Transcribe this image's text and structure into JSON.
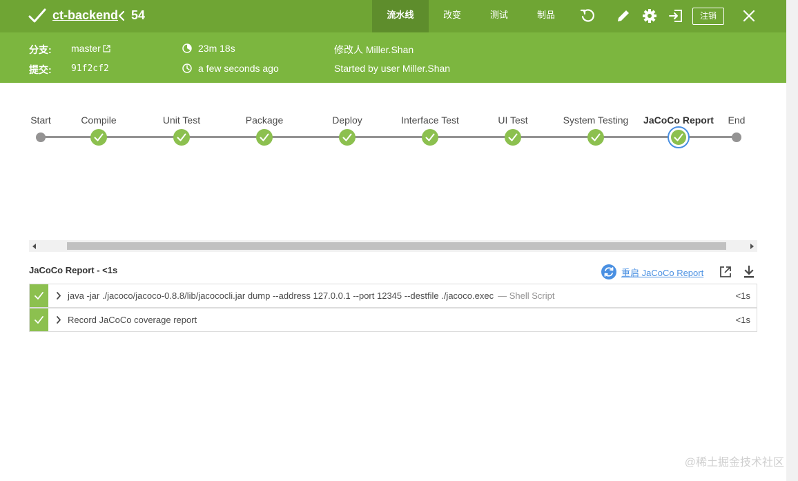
{
  "header": {
    "project_name": "ct-backend",
    "run_number": "54",
    "tabs": [
      {
        "label": "流水线",
        "active": true
      },
      {
        "label": "改变",
        "active": false
      },
      {
        "label": "测试",
        "active": false
      },
      {
        "label": "制品",
        "active": false
      }
    ],
    "logout_label": "注销",
    "icons": [
      "check-icon",
      "chevron-left-icon",
      "rerun-icon",
      "edit-icon",
      "gear-icon",
      "logout-icon",
      "close-icon"
    ]
  },
  "run_info": {
    "branch_label": "分支:",
    "branch_value": "master",
    "commit_label": "提交:",
    "commit_value": "91f2cf2",
    "duration": "23m 18s",
    "finished": "a few seconds ago",
    "changes_by": "修改人 Miller.Shan",
    "started_by": "Started by user Miller.Shan"
  },
  "pipeline": {
    "stages": [
      {
        "label": "Start",
        "status": "start"
      },
      {
        "label": "Compile",
        "status": "success"
      },
      {
        "label": "Unit Test",
        "status": "success"
      },
      {
        "label": "Package",
        "status": "success"
      },
      {
        "label": "Deploy",
        "status": "success"
      },
      {
        "label": "Interface Test",
        "status": "success"
      },
      {
        "label": "UI Test",
        "status": "success"
      },
      {
        "label": "System Testing",
        "status": "success"
      },
      {
        "label": "JaCoCo Report",
        "status": "success",
        "selected": true
      },
      {
        "label": "End",
        "status": "end"
      }
    ],
    "colors": {
      "success": "#8cc04f",
      "connector": "#949393",
      "selected_ring": "#4a90e2"
    }
  },
  "step_detail": {
    "title": "JaCoCo Report - <1s",
    "restart_label": "重启 JaCoCo Report",
    "steps": [
      {
        "text": "java -jar ./jacoco/jacoco-0.8.8/lib/jacococli.jar dump --address 127.0.0.1 --port 12345 --destfile ./jacoco.exec",
        "subtext": "— Shell Script",
        "duration": "<1s",
        "status": "success"
      },
      {
        "text": "Record JaCoCo coverage report",
        "subtext": "",
        "duration": "<1s",
        "status": "success"
      }
    ]
  },
  "watermark": "@稀土掘金技术社区",
  "theme": {
    "topbar": "#6fa534",
    "infobar": "#7cb63f",
    "link": "#4a90e2"
  }
}
